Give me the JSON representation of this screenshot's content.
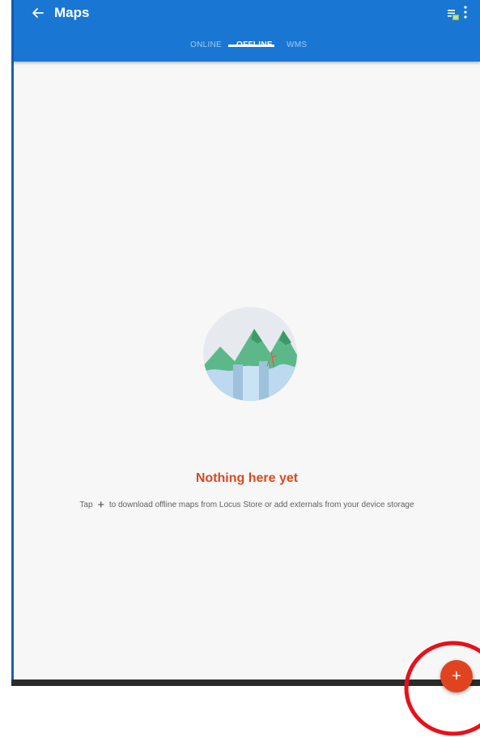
{
  "app": {
    "title": "Maps",
    "accent_color": "#1976d2",
    "fab_color": "#e0441e"
  },
  "header": {
    "back_icon": "arrow-left-icon",
    "actions": [
      {
        "icon": "layers-list-icon"
      },
      {
        "icon": "more-vertical-icon"
      }
    ]
  },
  "tabs": [
    {
      "label": "ONLINE",
      "active": false
    },
    {
      "label": "OFFLINE",
      "active": true
    },
    {
      "label": "WMS",
      "active": false
    }
  ],
  "empty_state": {
    "illustration": "mountains-map-icon",
    "title": "Nothing here yet",
    "description_prefix": "Tap",
    "description_icon": "+",
    "description_suffix": "to download offline maps from Locus Store or add externals from your device storage"
  },
  "fab": {
    "label": "+",
    "icon": "plus-icon"
  },
  "annotation": {
    "type": "red-circle-highlight",
    "color": "#e8101a"
  }
}
